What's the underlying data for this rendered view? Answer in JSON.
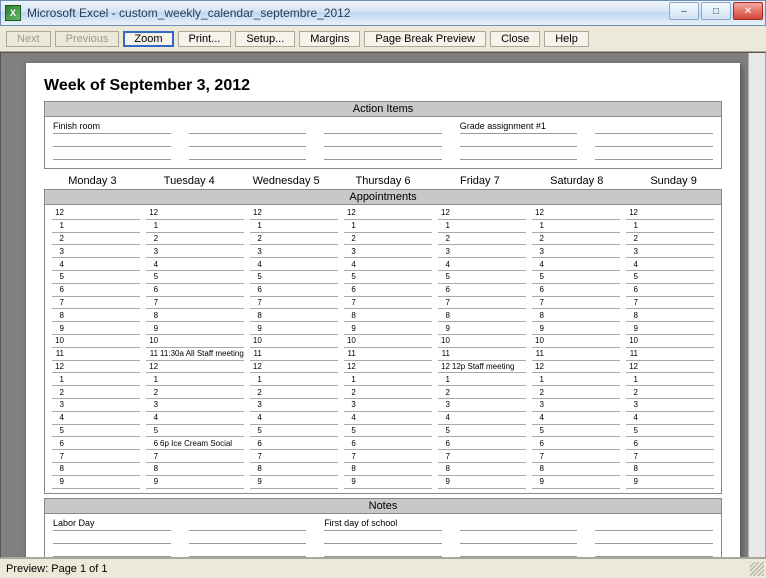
{
  "window": {
    "app_icon_letter": "X",
    "title": "Microsoft Excel - custom_weekly_calendar_septembre_2012"
  },
  "toolbar": {
    "next": "Next",
    "previous": "Previous",
    "zoom": "Zoom",
    "print": "Print...",
    "setup": "Setup...",
    "margins": "Margins",
    "page_break": "Page Break Preview",
    "close": "Close",
    "help": "Help"
  },
  "calendar": {
    "week_title": "Week of September 3, 2012",
    "action_items_header": "Action Items",
    "appointments_header": "Appointments",
    "notes_header": "Notes",
    "action_items": {
      "row1": [
        "Finish room",
        "",
        "",
        "Grade assignment #1",
        ""
      ],
      "row2": [
        "",
        "",
        "",
        "",
        ""
      ],
      "row3": [
        "",
        "",
        "",
        "",
        ""
      ]
    },
    "days": [
      "Monday 3",
      "Tuesday 4",
      "Wednesday 5",
      "Thursday 6",
      "Friday 7",
      "Saturday 8",
      "Sunday 9"
    ],
    "hours": [
      "12",
      "1",
      "2",
      "3",
      "4",
      "5",
      "6",
      "7",
      "8",
      "9",
      "10",
      "11",
      "12",
      "1",
      "2",
      "3",
      "4",
      "5",
      "6",
      "7",
      "8",
      "9"
    ],
    "appointments": {
      "Tuesday 4": {
        "11": "11:30a All Staff meeting",
        "18": "6p Ice Cream Social"
      },
      "Friday 7": {
        "12b": "12p Staff meeting"
      }
    },
    "notes": {
      "row1": [
        "Labor Day",
        "",
        "First day of school",
        "",
        ""
      ],
      "row2": [
        "",
        "",
        "",
        "",
        ""
      ],
      "row3": [
        "",
        "",
        "",
        "",
        ""
      ]
    }
  },
  "statusbar": {
    "text": "Preview: Page 1 of 1"
  }
}
